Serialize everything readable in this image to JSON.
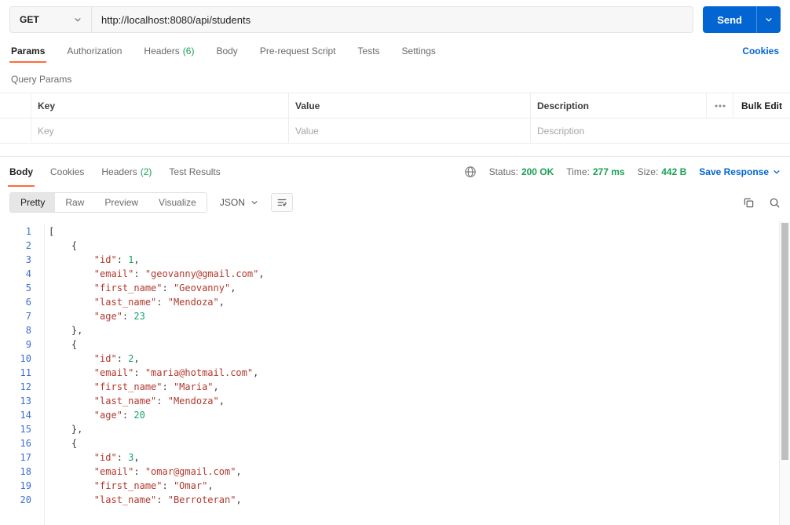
{
  "request": {
    "method": "GET",
    "url": "http://localhost:8080/api/students",
    "send_label": "Send"
  },
  "request_tabs": {
    "items": [
      {
        "label": "Params"
      },
      {
        "label": "Authorization"
      },
      {
        "label": "Headers",
        "count": "(6)"
      },
      {
        "label": "Body"
      },
      {
        "label": "Pre-request Script"
      },
      {
        "label": "Tests"
      },
      {
        "label": "Settings"
      }
    ],
    "cookies_link": "Cookies"
  },
  "query_params": {
    "title": "Query Params",
    "col_key": "Key",
    "col_value": "Value",
    "col_description": "Description",
    "bulk_edit_label": "Bulk Edit",
    "placeholder_key": "Key",
    "placeholder_value": "Value",
    "placeholder_description": "Description"
  },
  "response": {
    "tabs": [
      {
        "label": "Body"
      },
      {
        "label": "Cookies"
      },
      {
        "label": "Headers",
        "count": "(2)"
      },
      {
        "label": "Test Results"
      }
    ],
    "meta": {
      "status_label": "Status:",
      "status_value": "200 OK",
      "time_label": "Time:",
      "time_value": "277 ms",
      "size_label": "Size:",
      "size_value": "442 B",
      "save_label": "Save Response"
    },
    "toolbar": {
      "views": [
        {
          "label": "Pretty"
        },
        {
          "label": "Raw"
        },
        {
          "label": "Preview"
        },
        {
          "label": "Visualize"
        }
      ],
      "language": "JSON"
    }
  },
  "colors": {
    "accent_orange": "#ff6c37",
    "link_blue": "#0265d2",
    "status_green": "#1aa053",
    "token_string_red": "#b2392f",
    "token_number_green": "#16a36d",
    "line_number_blue": "#3b6fd4"
  },
  "code": {
    "lines": [
      {
        "num": 1,
        "parts": [
          [
            "t",
            "["
          ]
        ]
      },
      {
        "num": 2,
        "parts": [
          [
            "t",
            "    {"
          ]
        ]
      },
      {
        "num": 3,
        "parts": [
          [
            "t",
            "        "
          ],
          [
            "k",
            "\"id\""
          ],
          [
            "t",
            ": "
          ],
          [
            "d",
            "1"
          ],
          [
            "t",
            ","
          ]
        ]
      },
      {
        "num": 4,
        "parts": [
          [
            "t",
            "        "
          ],
          [
            "k",
            "\"email\""
          ],
          [
            "t",
            ": "
          ],
          [
            "s",
            "\"geovanny@gmail.com\""
          ],
          [
            "t",
            ","
          ]
        ]
      },
      {
        "num": 5,
        "parts": [
          [
            "t",
            "        "
          ],
          [
            "k",
            "\"first_name\""
          ],
          [
            "t",
            ": "
          ],
          [
            "s",
            "\"Geovanny\""
          ],
          [
            "t",
            ","
          ]
        ]
      },
      {
        "num": 6,
        "parts": [
          [
            "t",
            "        "
          ],
          [
            "k",
            "\"last_name\""
          ],
          [
            "t",
            ": "
          ],
          [
            "s",
            "\"Mendoza\""
          ],
          [
            "t",
            ","
          ]
        ]
      },
      {
        "num": 7,
        "parts": [
          [
            "t",
            "        "
          ],
          [
            "k",
            "\"age\""
          ],
          [
            "t",
            ": "
          ],
          [
            "d",
            "23"
          ]
        ]
      },
      {
        "num": 8,
        "parts": [
          [
            "t",
            "    },"
          ]
        ]
      },
      {
        "num": 9,
        "parts": [
          [
            "t",
            "    {"
          ]
        ]
      },
      {
        "num": 10,
        "parts": [
          [
            "t",
            "        "
          ],
          [
            "k",
            "\"id\""
          ],
          [
            "t",
            ": "
          ],
          [
            "d",
            "2"
          ],
          [
            "t",
            ","
          ]
        ]
      },
      {
        "num": 11,
        "parts": [
          [
            "t",
            "        "
          ],
          [
            "k",
            "\"email\""
          ],
          [
            "t",
            ": "
          ],
          [
            "s",
            "\"maria@hotmail.com\""
          ],
          [
            "t",
            ","
          ]
        ]
      },
      {
        "num": 12,
        "parts": [
          [
            "t",
            "        "
          ],
          [
            "k",
            "\"first_name\""
          ],
          [
            "t",
            ": "
          ],
          [
            "s",
            "\"Maria\""
          ],
          [
            "t",
            ","
          ]
        ]
      },
      {
        "num": 13,
        "parts": [
          [
            "t",
            "        "
          ],
          [
            "k",
            "\"last_name\""
          ],
          [
            "t",
            ": "
          ],
          [
            "s",
            "\"Mendoza\""
          ],
          [
            "t",
            ","
          ]
        ]
      },
      {
        "num": 14,
        "parts": [
          [
            "t",
            "        "
          ],
          [
            "k",
            "\"age\""
          ],
          [
            "t",
            ": "
          ],
          [
            "d",
            "20"
          ]
        ]
      },
      {
        "num": 15,
        "parts": [
          [
            "t",
            "    },"
          ]
        ]
      },
      {
        "num": 16,
        "parts": [
          [
            "t",
            "    {"
          ]
        ]
      },
      {
        "num": 17,
        "parts": [
          [
            "t",
            "        "
          ],
          [
            "k",
            "\"id\""
          ],
          [
            "t",
            ": "
          ],
          [
            "d",
            "3"
          ],
          [
            "t",
            ","
          ]
        ]
      },
      {
        "num": 18,
        "parts": [
          [
            "t",
            "        "
          ],
          [
            "k",
            "\"email\""
          ],
          [
            "t",
            ": "
          ],
          [
            "s",
            "\"omar@gmail.com\""
          ],
          [
            "t",
            ","
          ]
        ]
      },
      {
        "num": 19,
        "parts": [
          [
            "t",
            "        "
          ],
          [
            "k",
            "\"first_name\""
          ],
          [
            "t",
            ": "
          ],
          [
            "s",
            "\"Omar\""
          ],
          [
            "t",
            ","
          ]
        ]
      },
      {
        "num": 20,
        "parts": [
          [
            "t",
            "        "
          ],
          [
            "k",
            "\"last_name\""
          ],
          [
            "t",
            ": "
          ],
          [
            "s",
            "\"Berroteran\""
          ],
          [
            "t",
            ","
          ]
        ]
      }
    ]
  }
}
